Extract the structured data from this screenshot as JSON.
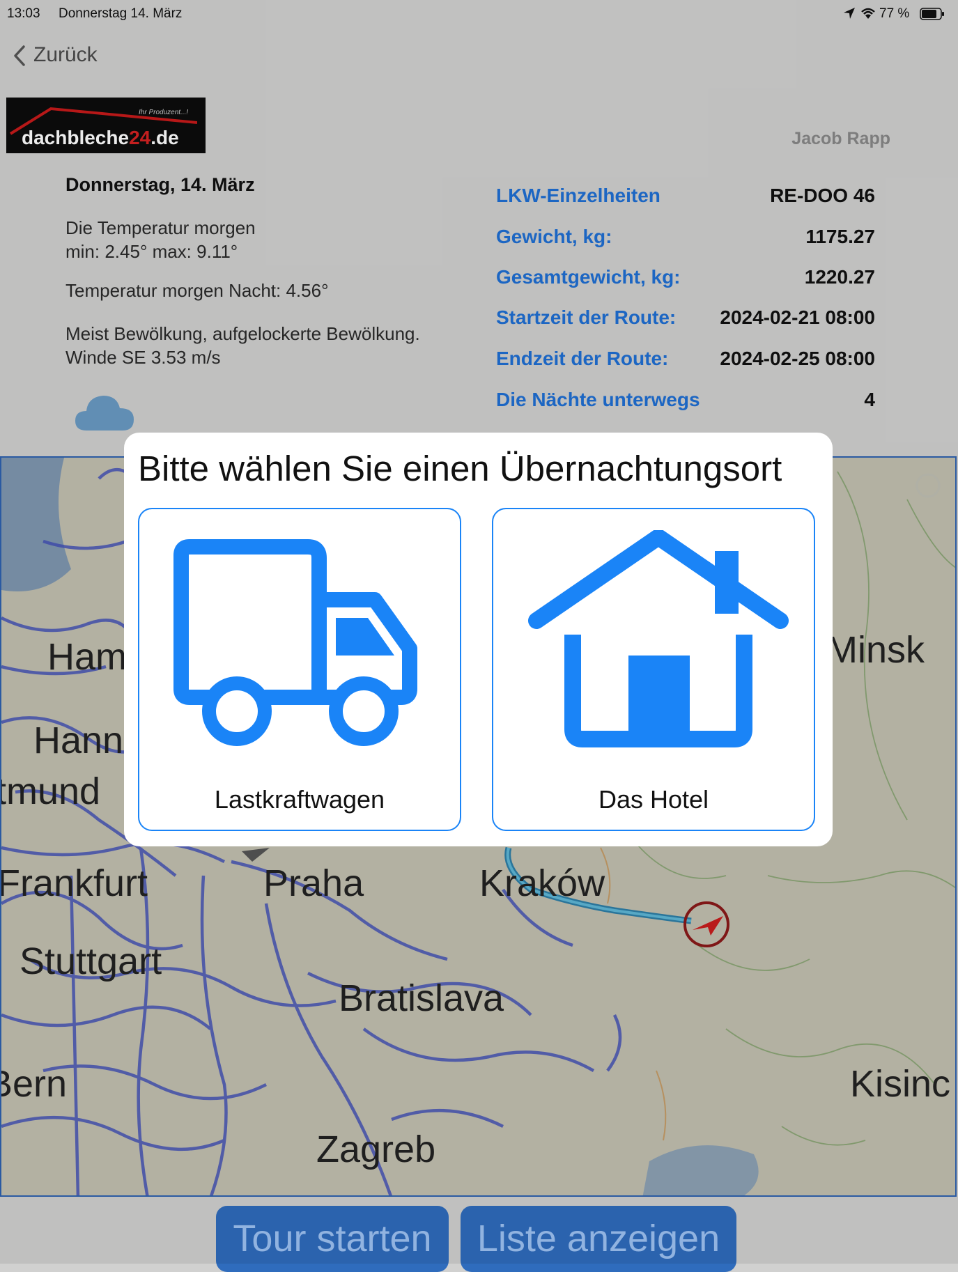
{
  "status_bar": {
    "time": "13:03",
    "date": "Donnerstag 14. März",
    "battery": "77 %"
  },
  "nav": {
    "back_label": "Zurück"
  },
  "logo": {
    "text_main": "dachbleche",
    "text_num": "24",
    "text_tld": ".de",
    "tagline": "Ihr Produzent...!"
  },
  "user": {
    "name": "Jacob Rapp"
  },
  "weather": {
    "date": "Donnerstag, 14. März",
    "temp_line1": "Die Temperatur morgen",
    "temp_line2": "min: 2.45° max: 9.11°",
    "night": "Temperatur morgen Nacht: 4.56°",
    "desc_line1": "Meist Bewölkung, aufgelockerte Bewölkung.",
    "desc_line2": "Winde SE 3.53 m/s",
    "icon": "cloud-icon"
  },
  "details": [
    {
      "label": "LKW-Einzelheiten",
      "value": "RE-DOO 46"
    },
    {
      "label": "Gewicht, kg:",
      "value": "1175.27"
    },
    {
      "label": "Gesamtgewicht, kg:",
      "value": "1220.27"
    },
    {
      "label": "Startzeit der Route:",
      "value": "2024-02-21 08:00"
    },
    {
      "label": "Endzeit der Route:",
      "value": "2024-02-25 08:00"
    },
    {
      "label": "Die Nächte unterwegs",
      "value": "4"
    }
  ],
  "map": {
    "cities": [
      "Ham",
      "Hann",
      "tmund",
      "Frankfurt",
      "Praha",
      "Kraków",
      "Stuttgart",
      "Bratislava",
      "Bern",
      "Zagreb",
      "Minsk",
      "Kisinc"
    ]
  },
  "modal": {
    "title": "Bitte wählen Sie einen Übernachtungsort",
    "option_truck": "Lastkraftwagen",
    "option_hotel": "Das Hotel",
    "accent": "#1a84f7"
  },
  "buttons": {
    "start": "Tour starten",
    "list": "Liste anzeigen"
  }
}
